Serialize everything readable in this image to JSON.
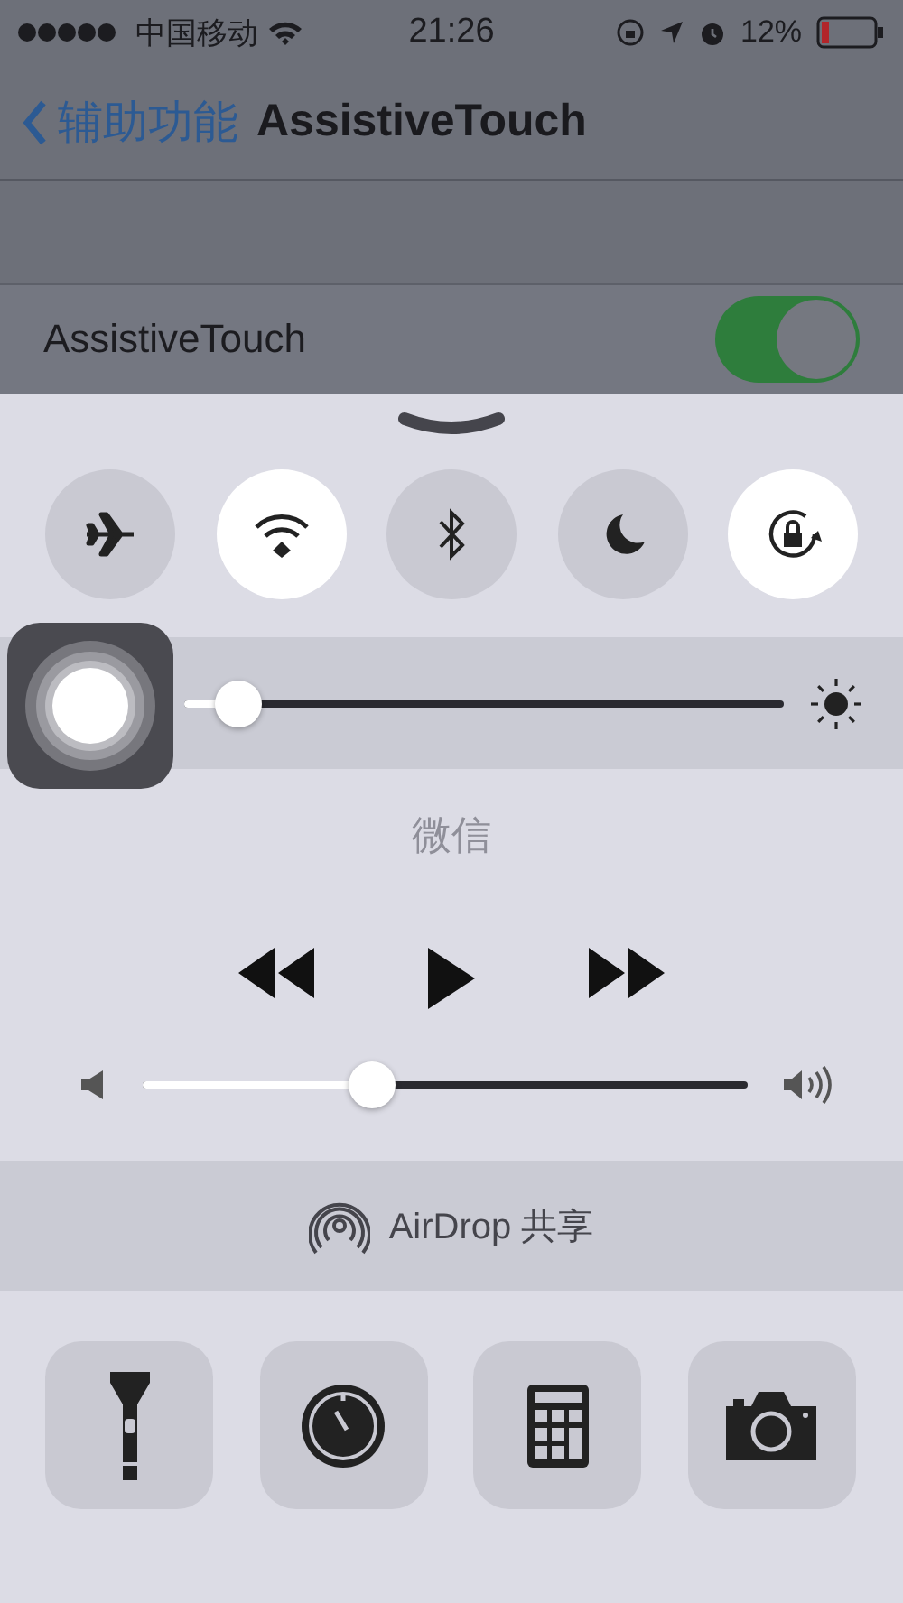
{
  "status_bar": {
    "carrier": "中国移动",
    "time": "21:26",
    "battery": "12%"
  },
  "nav": {
    "back": "辅助功能",
    "title": "AssistiveTouch"
  },
  "settings": [
    {
      "label": "AssistiveTouch",
      "on": true
    }
  ],
  "control_center": {
    "toggles": [
      {
        "kind": "airplane",
        "on": false
      },
      {
        "kind": "wifi",
        "on": true
      },
      {
        "kind": "bluetooth",
        "on": false
      },
      {
        "kind": "moon",
        "on": false
      },
      {
        "kind": "rotation-lock",
        "on": true
      }
    ],
    "brightness": {
      "level": 0.09
    },
    "now_playing": {
      "title": "微信"
    },
    "media_controls": [
      {
        "kind": "rewind"
      },
      {
        "kind": "play"
      },
      {
        "kind": "forward"
      }
    ],
    "volume": {
      "level": 0.38
    },
    "airdrop": {
      "label": "AirDrop 共享"
    },
    "shortcuts": [
      {
        "kind": "flashlight"
      },
      {
        "kind": "timer"
      },
      {
        "kind": "calculator"
      },
      {
        "kind": "camera"
      }
    ]
  }
}
